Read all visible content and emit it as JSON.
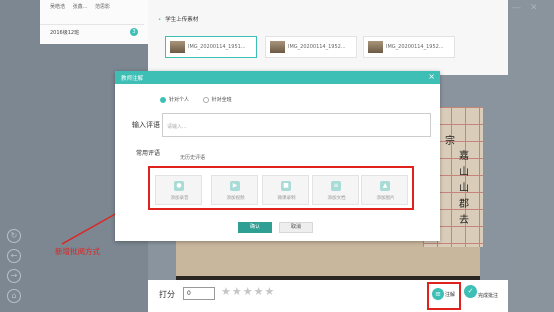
{
  "left_panel": {
    "names": [
      "吴皓浩",
      "张鑫...",
      "范思影"
    ],
    "row_date": "2016级12班",
    "row_badge": "3"
  },
  "main": {
    "section_title": "学生上传素材",
    "thumbnails": [
      {
        "name": "IMG_20200114_1951..."
      },
      {
        "name": "IMG_20200114_1952..."
      },
      {
        "name": "IMG_20200114_1952..."
      }
    ]
  },
  "photo_chars": [
    "宗",
    "嘉",
    "山",
    "山",
    "郡",
    "去"
  ],
  "modal": {
    "title": "教师注解",
    "close": "×",
    "radio_personal": "针对个人",
    "radio_all": "针对全班",
    "comment_label": "输入评语",
    "comment_placeholder": "请输入...",
    "common_label": "常用评语",
    "no_history": "无历史评语",
    "tools": [
      {
        "label": "添加录音",
        "icon": "microphone-icon",
        "glyph": "●"
      },
      {
        "label": "添加视频",
        "icon": "video-file-icon",
        "glyph": "▶"
      },
      {
        "label": "微课录制",
        "icon": "camera-icon",
        "glyph": "■"
      },
      {
        "label": "添加文档",
        "icon": "document-icon",
        "glyph": "≡"
      },
      {
        "label": "添加图片",
        "icon": "image-icon",
        "glyph": "▲"
      }
    ],
    "ok": "确认",
    "cancel": "取消"
  },
  "bottom": {
    "score_label": "打分",
    "score_value": "0",
    "stars": "★★★★★",
    "rating": 0,
    "annotate": "注解",
    "complete": "完成批注"
  },
  "callout": "新增批阅方式",
  "colors": {
    "accent": "#3dbfb5",
    "highlight": "#e0221e"
  }
}
